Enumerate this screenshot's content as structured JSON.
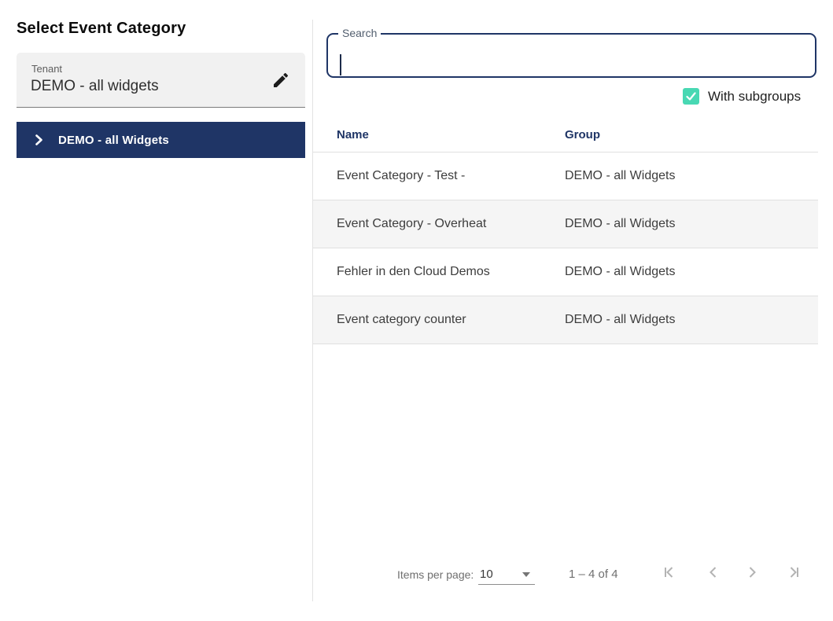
{
  "colors": {
    "navy": "#1f3566",
    "teal": "#48d8b3"
  },
  "title": "Select Event Category",
  "tenant": {
    "label": "Tenant",
    "value": "DEMO - all widgets",
    "edit_icon": "pencil-icon"
  },
  "tree": {
    "selected_item": "DEMO - all Widgets",
    "icon": "chevron-right-icon"
  },
  "search": {
    "label": "Search",
    "value": ""
  },
  "filter": {
    "label": "With subgroups",
    "checked": true,
    "icon": "check-icon"
  },
  "table": {
    "columns": {
      "name": "Name",
      "group": "Group"
    },
    "rows": [
      {
        "name": "Event Category - Test -",
        "group": "DEMO - all Widgets"
      },
      {
        "name": "Event Category - Overheat",
        "group": "DEMO - all Widgets"
      },
      {
        "name": "Fehler in den Cloud Demos",
        "group": "DEMO - all Widgets"
      },
      {
        "name": "Event category counter",
        "group": "DEMO - all Widgets"
      }
    ]
  },
  "paginator": {
    "items_per_page_label": "Items per page:",
    "items_per_page_value": "10",
    "range_label": "1 – 4 of 4",
    "icons": [
      "first-page-icon",
      "chevron-left-icon",
      "chevron-right-icon",
      "last-page-icon"
    ]
  }
}
